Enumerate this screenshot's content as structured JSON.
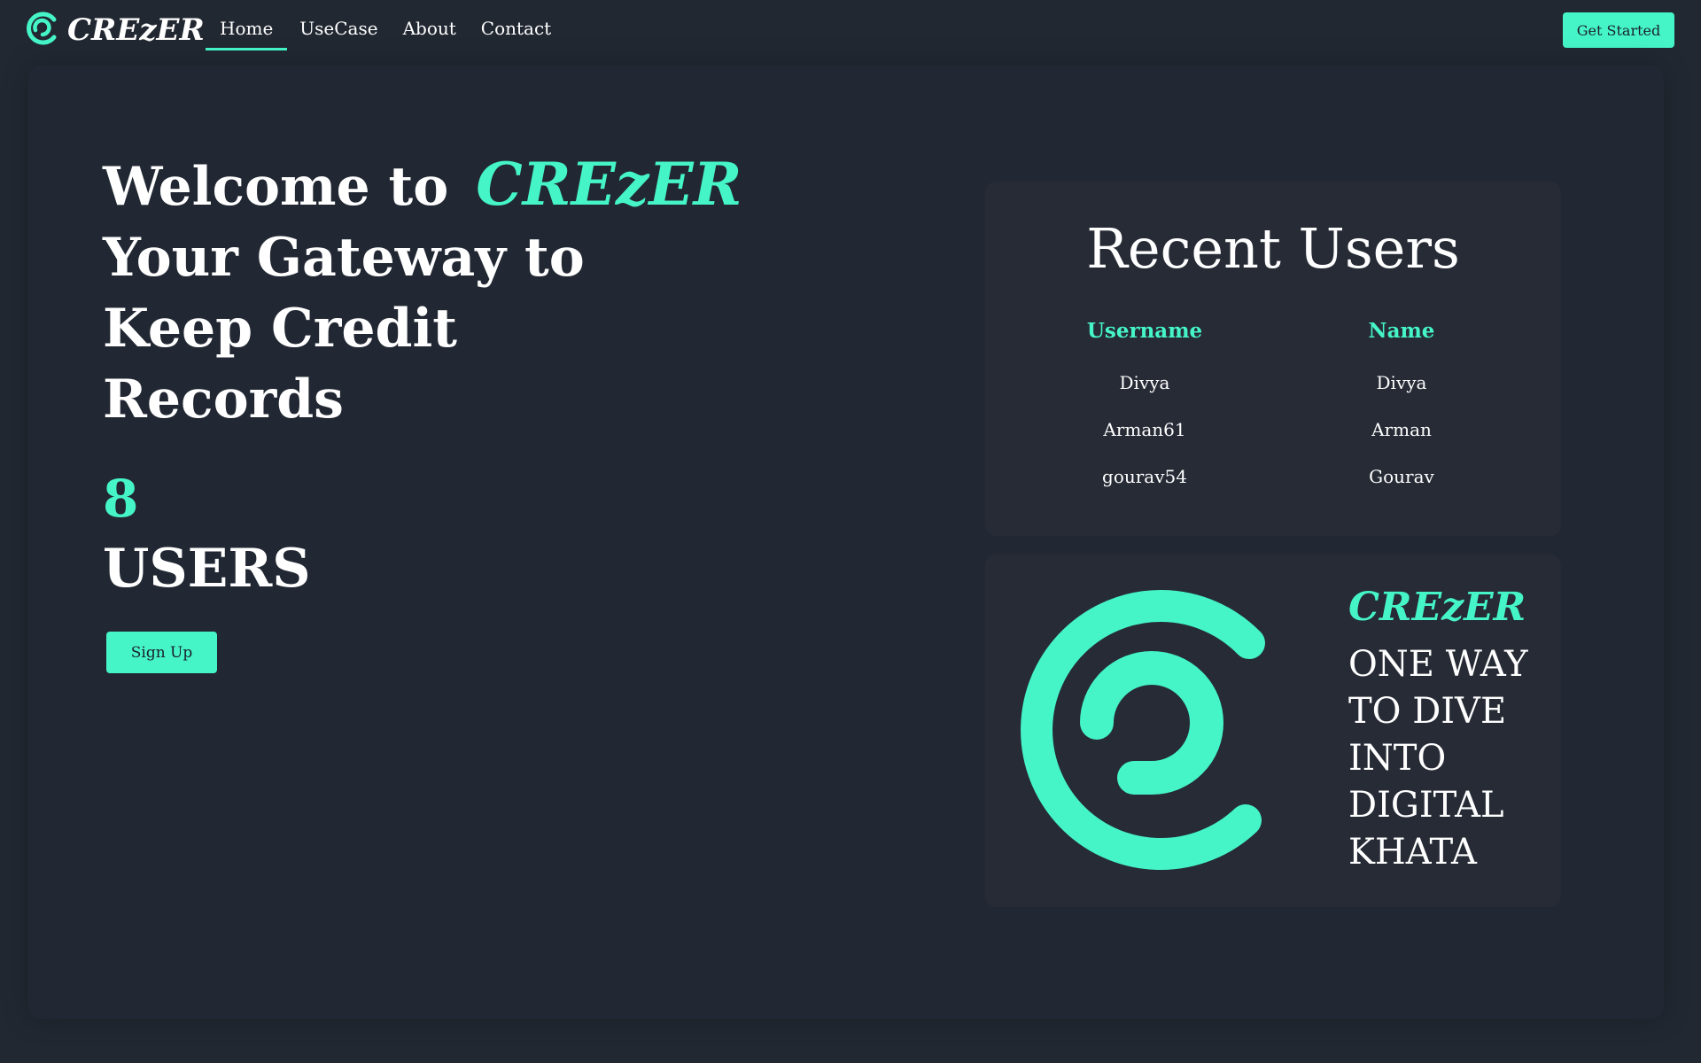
{
  "header": {
    "brand": "CREzER",
    "nav": [
      {
        "label": "Home",
        "active": true
      },
      {
        "label": "UseCase",
        "active": false
      },
      {
        "label": "About",
        "active": false
      },
      {
        "label": "Contact",
        "active": false
      }
    ],
    "cta_label": "Get Started"
  },
  "hero": {
    "line1_prefix": "Welcome to",
    "line1_brand": "CREzER",
    "line2": "Your Gateway to",
    "line3": "Keep Credit",
    "line4": "Records",
    "user_count": "8",
    "user_label": "USERS",
    "signup_label": "Sign Up"
  },
  "recent_users": {
    "title": "Recent Users",
    "columns": [
      "Username",
      "Name"
    ],
    "rows": [
      {
        "username": "Divya",
        "name": "Divya"
      },
      {
        "username": "Arman61",
        "name": "Arman"
      },
      {
        "username": "gourav54",
        "name": "Gourav"
      }
    ]
  },
  "promo": {
    "brand": "CREzER",
    "lines": [
      "ONE WAY",
      "TO DIVE",
      "INTO",
      "DIGITAL",
      "KHATA"
    ]
  },
  "colors": {
    "accent": "#45f5c8",
    "background": "#222832",
    "card": "#262b36"
  },
  "icons": {
    "logo": "crezer-logo-icon"
  }
}
